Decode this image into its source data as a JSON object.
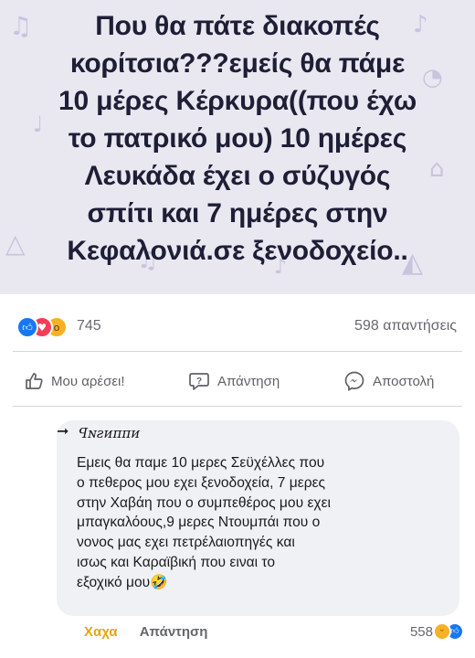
{
  "post": {
    "lines": [
      "Που θα πάτε διακοπές",
      "κορίτσια???εμείς θα πάμε",
      "10 μέρες Κέρκυρα((που έχω",
      "το πατρικό μου) 10 ημέρες",
      "Λευκάδα έχει ο σύζυγός",
      "σπίτι  και 7 ημέρες στην",
      "Κεφαλονιά.σε ξενοδοχείο.."
    ],
    "background_color": "#e9e7f0",
    "text_color": "#1e1e36"
  },
  "reactions": {
    "icons": [
      "like-icon",
      "love-icon",
      "wow-icon"
    ],
    "count": "745",
    "replies": "598 απαντήσεις"
  },
  "actions": {
    "like_label": "Μου αρέσει!",
    "comment_label": "Απάντηση",
    "send_label": "Αποστολή"
  },
  "comment": {
    "author": "ꟼɴꙅᴎᴨᴨᴎ",
    "lines": [
      "Εμεις θα παμε 10 μερες Σεϋχέλλες που",
      "ο πεθερος μου εχει ξενοδοχεία, 7 μερες",
      "στην Χαβάη που ο συμπεθέρος μου  εχει",
      "μπαγκαλόους,9 μερες Ντουμπάι που ο",
      "νονος μας εχει πετρέλαιοπηγές και",
      "ισως και Καραϊβική  που ειναι το",
      "εξοχικό μου🤣"
    ],
    "like_label": "Χαχα",
    "reply_label": "Απάντηση",
    "reaction_count": "558",
    "reaction_icons": [
      "haha-icon",
      "like-icon"
    ]
  }
}
